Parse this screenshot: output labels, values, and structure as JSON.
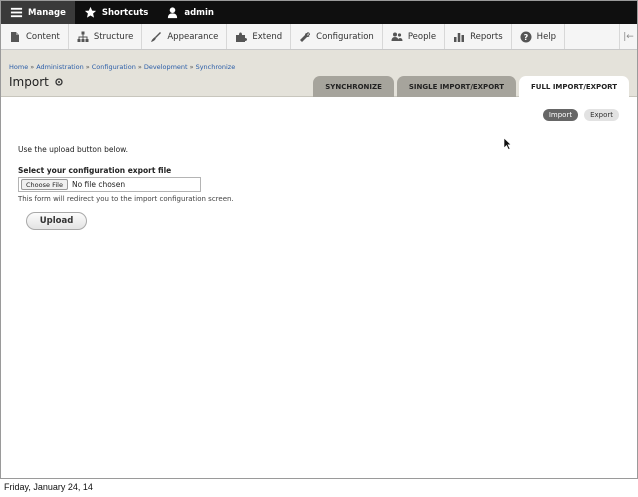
{
  "toolbar": {
    "items": [
      {
        "label": "Manage",
        "icon": "menu-icon",
        "active": true
      },
      {
        "label": "Shortcuts",
        "icon": "star-icon"
      },
      {
        "label": "admin",
        "icon": "person-icon"
      }
    ]
  },
  "tray": {
    "items": [
      {
        "label": "Content",
        "icon": "page-icon"
      },
      {
        "label": "Structure",
        "icon": "sitemap-icon"
      },
      {
        "label": "Appearance",
        "icon": "brush-icon"
      },
      {
        "label": "Extend",
        "icon": "puzzle-icon"
      },
      {
        "label": "Configuration",
        "icon": "wrench-icon"
      },
      {
        "label": "People",
        "icon": "people-icon"
      },
      {
        "label": "Reports",
        "icon": "bar-chart-icon"
      },
      {
        "label": "Help",
        "icon": "help-icon"
      }
    ],
    "end_glyph": "|←"
  },
  "breadcrumb": {
    "items": [
      "Home",
      "Administration",
      "Configuration",
      "Development",
      "Synchronize"
    ],
    "separator": "»"
  },
  "page": {
    "title": "Import"
  },
  "tabs": [
    {
      "label": "SYNCHRONIZE",
      "active": false
    },
    {
      "label": "SINGLE IMPORT/EXPORT",
      "active": false
    },
    {
      "label": "FULL IMPORT/EXPORT",
      "active": true
    }
  ],
  "subtabs": [
    {
      "label": "Import",
      "active": true
    },
    {
      "label": "Export",
      "active": false
    }
  ],
  "form": {
    "help_text": "Use the upload button below.",
    "field_label": "Select your configuration export file",
    "choose_file_label": "Choose File",
    "file_status": "No file chosen",
    "description": "This form will redirect you to the import configuration screen.",
    "submit_label": "Upload"
  },
  "footer": {
    "date": "Friday, January 24, 14"
  },
  "colors": {
    "toolbar_bg": "#0f0f0f",
    "header_bg": "#e4e2da",
    "link": "#2a5da8",
    "active_subtab": "#666666"
  }
}
